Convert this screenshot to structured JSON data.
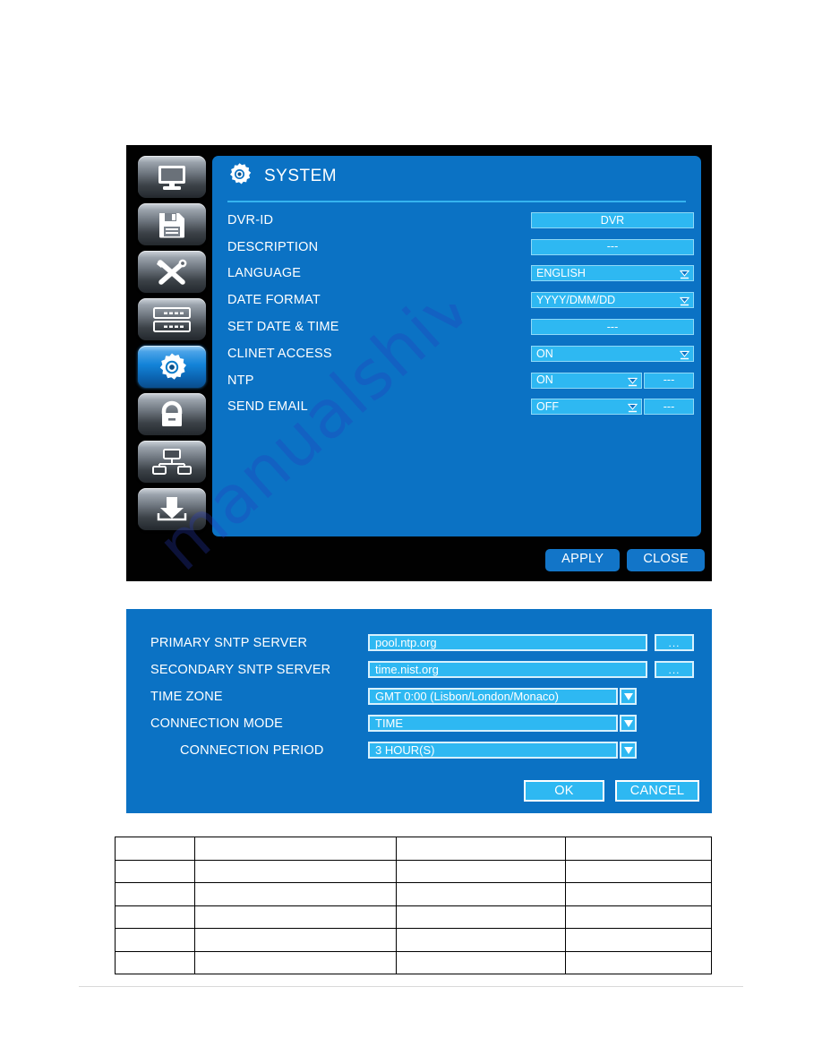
{
  "watermark": {
    "text": "manualshive.com"
  },
  "system_window": {
    "sidebar": {
      "items": [
        {
          "name": "display-settings",
          "icon": "monitor-icon",
          "active": false
        },
        {
          "name": "record-settings",
          "icon": "floppy-disk-icon",
          "active": false
        },
        {
          "name": "tools-settings",
          "icon": "screwdriver-wrench-icon",
          "active": false
        },
        {
          "name": "device-settings",
          "icon": "server-rack-icon",
          "active": false
        },
        {
          "name": "system-settings",
          "icon": "gear-icon",
          "active": true
        },
        {
          "name": "security-settings",
          "icon": "lock-icon",
          "active": false
        },
        {
          "name": "network-settings",
          "icon": "network-icon",
          "active": false
        },
        {
          "name": "backup-settings",
          "icon": "download-arrow-icon",
          "active": false
        }
      ]
    },
    "panel": {
      "title": "SYSTEM",
      "title_icon": "gear-icon",
      "rows": [
        {
          "label": "DVR-ID",
          "type": "text",
          "value": "DVR"
        },
        {
          "label": "DESCRIPTION",
          "type": "text",
          "value": "---"
        },
        {
          "label": "LANGUAGE",
          "type": "dropdown",
          "value": "ENGLISH"
        },
        {
          "label": "DATE FORMAT",
          "type": "dropdown",
          "value": "YYYY/DMM/DD"
        },
        {
          "label": "SET DATE & TIME",
          "type": "text",
          "value": "---"
        },
        {
          "label": "CLINET ACCESS",
          "type": "dropdown",
          "value": "ON"
        },
        {
          "label": "NTP",
          "type": "split",
          "value": "ON",
          "extra": "---"
        },
        {
          "label": "SEND EMAIL",
          "type": "split",
          "value": "OFF",
          "extra": "---"
        }
      ]
    },
    "buttons": {
      "apply": "APPLY",
      "close": "CLOSE"
    }
  },
  "ntp_dialog": {
    "rows": [
      {
        "label": "PRIMARY SNTP SERVER",
        "type": "input",
        "value": "pool.ntp.org",
        "aux": "..."
      },
      {
        "label": "SECONDARY  SNTP SERVER",
        "type": "input",
        "value": "time.nist.org",
        "aux": "..."
      },
      {
        "label": "TIME ZONE",
        "type": "dropdown",
        "value": "GMT 0:00 (Lisbon/London/Monaco)"
      },
      {
        "label": "CONNECTION MODE",
        "type": "dropdown",
        "value": "TIME"
      },
      {
        "label": "CONNECTION PERIOD",
        "type": "dropdown",
        "value": "3 HOUR(S)",
        "indented": true
      }
    ],
    "buttons": {
      "ok": "OK",
      "cancel": "CANCEL"
    }
  },
  "bottom_table": {
    "rows": [
      [
        "",
        "",
        "",
        ""
      ],
      [
        "",
        "",
        "",
        ""
      ],
      [
        "",
        "",
        "",
        ""
      ],
      [
        "",
        "",
        "",
        ""
      ],
      [
        "",
        "",
        "",
        ""
      ],
      [
        "",
        "",
        "",
        ""
      ]
    ]
  },
  "colors": {
    "panel_blue": "#0b72c4",
    "field_blue": "#2eb8f2",
    "window_black": "#010101",
    "button_blue": "#1275c8",
    "rule_blue": "#35b3ef"
  }
}
